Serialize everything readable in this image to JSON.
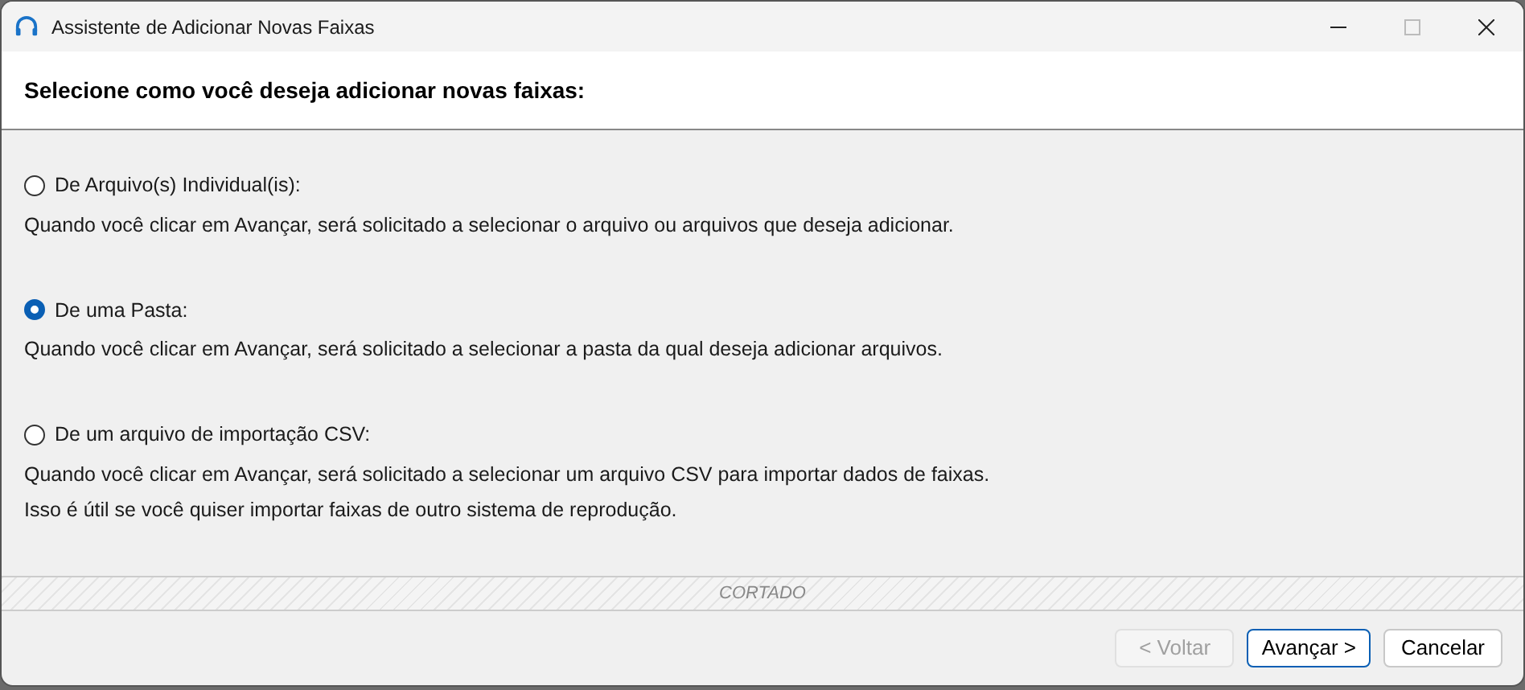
{
  "window": {
    "title": "Assistente de Adicionar Novas Faixas"
  },
  "header": {
    "title": "Selecione como você deseja adicionar novas faixas:"
  },
  "options": [
    {
      "label": "De Arquivo(s) Individual(is):",
      "selected": false,
      "description": [
        "Quando você clicar em Avançar, será solicitado a selecionar o arquivo ou arquivos que deseja adicionar."
      ]
    },
    {
      "label": "De uma Pasta:",
      "selected": true,
      "description": [
        "Quando você clicar em Avançar, será solicitado a selecionar a pasta da qual deseja adicionar arquivos."
      ]
    },
    {
      "label": "De um arquivo de importação CSV:",
      "selected": false,
      "description": [
        "Quando você clicar em Avançar, será solicitado a selecionar um arquivo CSV para importar dados de faixas.",
        "Isso é útil se você quiser importar faixas de outro sistema de reprodução."
      ]
    }
  ],
  "cut_marker": "CORTADO",
  "buttons": [
    {
      "label": "< Voltar",
      "disabled": true,
      "default": false
    },
    {
      "label": "Avançar >",
      "disabled": false,
      "default": true
    },
    {
      "label": "Cancelar",
      "disabled": false,
      "default": false
    }
  ]
}
